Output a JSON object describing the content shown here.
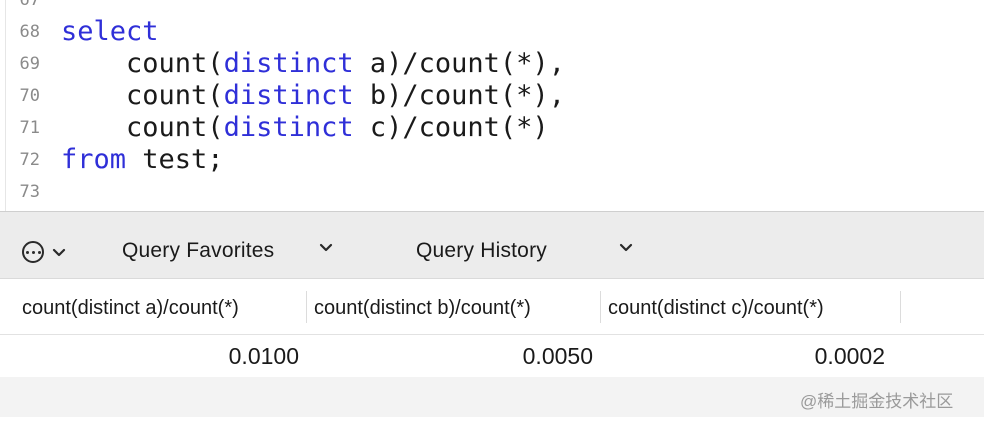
{
  "editor": {
    "line_numbers": [
      "67",
      "68",
      "69",
      "70",
      "71",
      "72",
      "73"
    ],
    "lines": [
      {
        "indent": "",
        "keyword": "select",
        "after": ""
      },
      {
        "indent": "    ",
        "before": "count(",
        "keyword": "distinct",
        "after": " a)/count(*),"
      },
      {
        "indent": "    ",
        "before": "count(",
        "keyword": "distinct",
        "after": " b)/count(*),"
      },
      {
        "indent": "    ",
        "before": "count(",
        "keyword": "distinct",
        "after": " c)/count(*)"
      },
      {
        "indent": "",
        "keyword": "from",
        "after": " test;"
      }
    ],
    "colors": {
      "keyword": "#2f2fd8",
      "text": "#1a1a1a",
      "gutter": "#8a8a8a"
    }
  },
  "toolbar": {
    "more_icon": "ellipsis-circle-icon",
    "favorites_label": "Query Favorites",
    "history_label": "Query History"
  },
  "results": {
    "columns": [
      "count(distinct a)/count(*)",
      "count(distinct b)/count(*)",
      "count(distinct c)/count(*)"
    ],
    "rows": [
      [
        "0.0100",
        "0.0050",
        "0.0002"
      ]
    ]
  },
  "watermark": {
    "text": "@稀土掘金技术社区"
  }
}
